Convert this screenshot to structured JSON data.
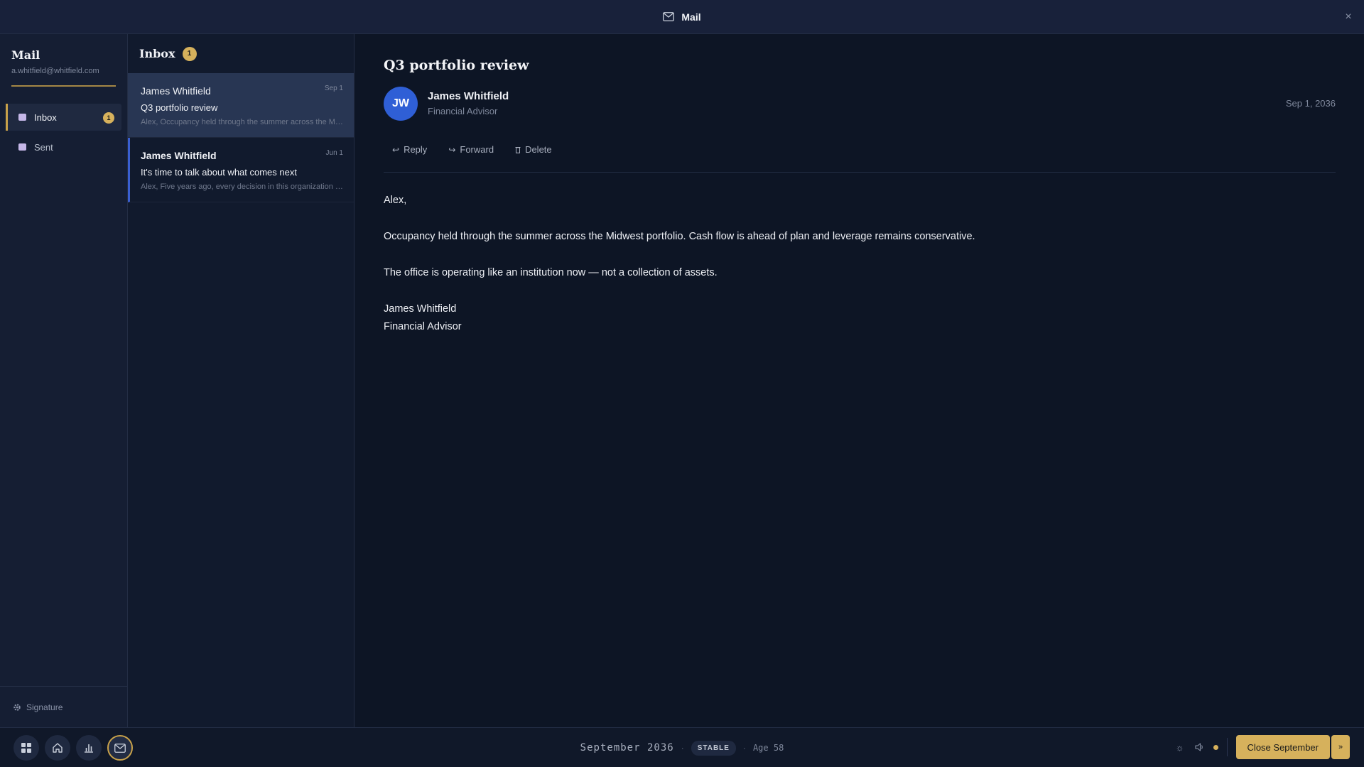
{
  "window": {
    "title": "Mail",
    "close_glyph": "×"
  },
  "sidebar": {
    "app_name": "Mail",
    "account_email": "a.whitfield@whitfield.com",
    "items": [
      {
        "label": "Inbox",
        "badge": "1",
        "active": true,
        "icon": "folder-icon"
      },
      {
        "label": "Sent",
        "badge": "",
        "active": false,
        "icon": "folder-icon"
      }
    ],
    "footer_label": "Signature"
  },
  "inbox": {
    "title": "Inbox",
    "badge": "1",
    "messages": [
      {
        "sender": "James Whitfield",
        "date": "Sep 1",
        "subject": "Q3 portfolio review",
        "preview": "Alex, Occupancy held through the summer across the Midwest portfolio. Cash flow is ahead of plan.",
        "selected": true,
        "unread": false
      },
      {
        "sender": "James Whitfield",
        "date": "Jun 1",
        "subject": "It's time to talk about what comes next",
        "preview": "Alex, Five years ago, every decision in this organization ran through you.",
        "selected": false,
        "unread": true
      }
    ]
  },
  "reader": {
    "subject": "Q3 portfolio review",
    "avatar_initials": "JW",
    "from_name": "James Whitfield",
    "from_role": "Financial Advisor",
    "date": "Sep 1, 2036",
    "actions": {
      "reply": "Reply",
      "forward": "Forward",
      "delete": "Delete"
    },
    "body": {
      "greeting": "Alex,",
      "p1": "Occupancy held through the summer across the Midwest portfolio. Cash flow is ahead of plan and leverage remains conservative.",
      "p2": "The office is operating like an institution now — not a collection of assets.",
      "sig_name": "James Whitfield",
      "sig_role": "Financial Advisor"
    }
  },
  "taskbar": {
    "month": "September 2036",
    "status": "STABLE",
    "age": "Age 58",
    "separator": "·",
    "close_button": "Close September",
    "close_arrow": "»"
  },
  "colors": {
    "accent_gold": "#d6b15c",
    "avatar_blue": "#2f5fd6",
    "background": "#0d1525",
    "selected_row": "#283653"
  }
}
